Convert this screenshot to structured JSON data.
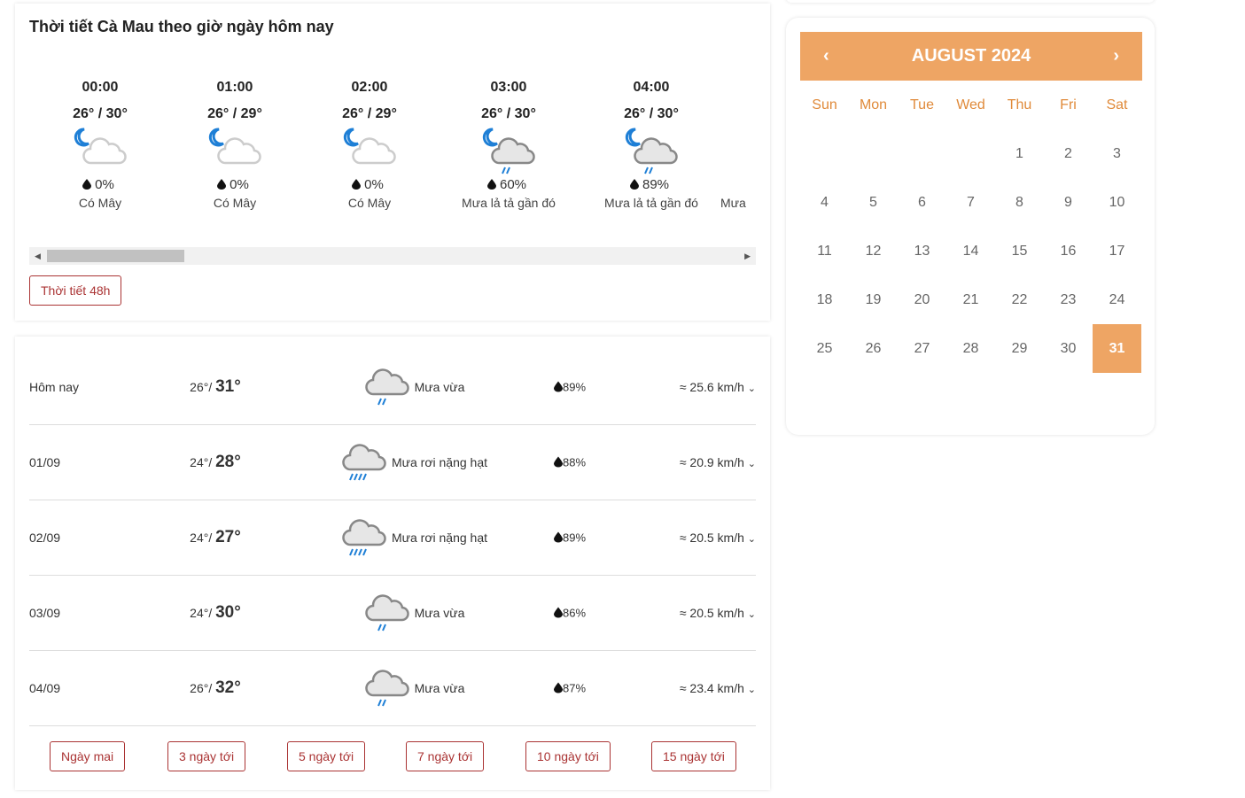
{
  "hourly": {
    "title": "Thời tiết Cà Mau theo giờ ngày hôm nay",
    "items": [
      {
        "time": "00:00",
        "temp": "26° / 30°",
        "pop": "0%",
        "desc": "Có Mây",
        "icon": "night-cloud-icon"
      },
      {
        "time": "01:00",
        "temp": "26° / 29°",
        "pop": "0%",
        "desc": "Có Mây",
        "icon": "night-cloud-icon"
      },
      {
        "time": "02:00",
        "temp": "26° / 29°",
        "pop": "0%",
        "desc": "Có Mây",
        "icon": "night-cloud-icon"
      },
      {
        "time": "03:00",
        "temp": "26° / 30°",
        "pop": "60%",
        "desc": "Mưa lả tả gần đó",
        "icon": "night-rain-icon"
      },
      {
        "time": "04:00",
        "temp": "26° / 30°",
        "pop": "89%",
        "desc": "Mưa lả tả gần đó",
        "icon": "night-rain-icon"
      },
      {
        "time": "",
        "temp": "",
        "pop": "",
        "desc": "Mưa",
        "icon": ""
      }
    ],
    "button": "Thời tiết 48h"
  },
  "daily": {
    "rows": [
      {
        "date": "Hôm nay",
        "low": "26°",
        "high": "31°",
        "desc": "Mưa vừa",
        "hum": "89%",
        "wind": "25.6 km/h",
        "rain": 2
      },
      {
        "date": "01/09",
        "low": "24°",
        "high": "28°",
        "desc": "Mưa rơi nặng hạt",
        "hum": "88%",
        "wind": "20.9 km/h",
        "rain": 4
      },
      {
        "date": "02/09",
        "low": "24°",
        "high": "27°",
        "desc": "Mưa rơi nặng hạt",
        "hum": "89%",
        "wind": "20.5 km/h",
        "rain": 4
      },
      {
        "date": "03/09",
        "low": "24°",
        "high": "30°",
        "desc": "Mưa vừa",
        "hum": "86%",
        "wind": "20.5 km/h",
        "rain": 2
      },
      {
        "date": "04/09",
        "low": "26°",
        "high": "32°",
        "desc": "Mưa vừa",
        "hum": "87%",
        "wind": "23.4 km/h",
        "rain": 2
      }
    ],
    "buttons": [
      "Ngày mai",
      "3 ngày tới",
      "5 ngày tới",
      "7 ngày tới",
      "10 ngày tới",
      "15 ngày tới"
    ]
  },
  "calendar": {
    "title": "AUGUST 2024",
    "prev": "‹",
    "next": "›",
    "weekdays": [
      "Sun",
      "Mon",
      "Tue",
      "Wed",
      "Thu",
      "Fri",
      "Sat"
    ],
    "first_weekday": 4,
    "days": 31,
    "selected": 31,
    "accent": "#eea564"
  }
}
